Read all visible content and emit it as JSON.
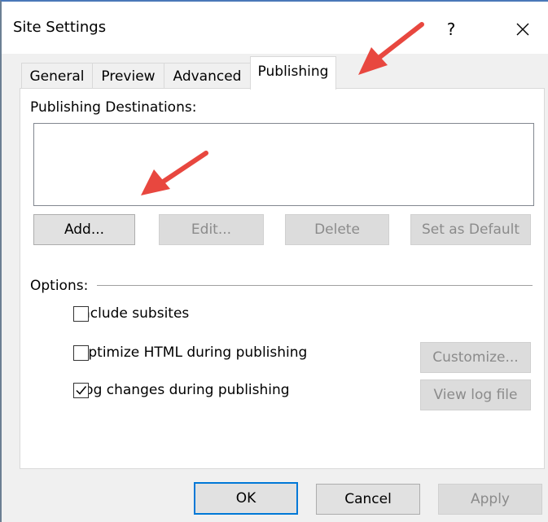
{
  "window": {
    "title": "Site Settings",
    "help_glyph": "?",
    "close_icon": "close-icon"
  },
  "tabs": [
    {
      "label": "General",
      "active": false
    },
    {
      "label": "Preview",
      "active": false
    },
    {
      "label": "Advanced",
      "active": false
    },
    {
      "label": "Publishing",
      "active": true
    }
  ],
  "publishing": {
    "destinations_label": "Publishing Destinations:",
    "destinations": [],
    "buttons": {
      "add": "Add...",
      "edit": "Edit...",
      "delete": "Delete",
      "set_default": "Set as Default"
    }
  },
  "options": {
    "label": "Options:",
    "include_subsites": {
      "label": "Include subsites",
      "checked": false
    },
    "optimize_html": {
      "label": "Optimize HTML during publishing",
      "checked": false
    },
    "log_changes": {
      "label": "Log changes during publishing",
      "checked": true
    },
    "customize_button": "Customize...",
    "view_log_button": "View log file"
  },
  "footer": {
    "ok": "OK",
    "cancel": "Cancel",
    "apply": "Apply"
  },
  "colors": {
    "accent": "#0078d7",
    "annotation_arrow": "#e8473f"
  }
}
